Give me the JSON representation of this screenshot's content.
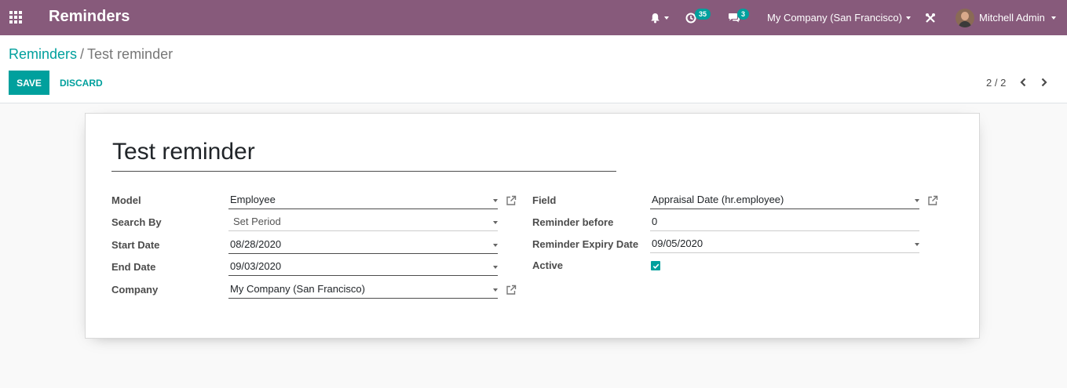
{
  "navbar": {
    "app_title": "Reminders",
    "activity_count": "35",
    "messages_count": "3",
    "company": "My Company (San Francisco)",
    "user_name": "Mitchell Admin"
  },
  "breadcrumb": {
    "parent": "Reminders",
    "separator": "/",
    "current": "Test reminder"
  },
  "buttons": {
    "save": "SAVE",
    "discard": "DISCARD"
  },
  "pager": {
    "value": "2 / 2"
  },
  "form": {
    "name": "Test reminder",
    "left": {
      "model_label": "Model",
      "model_value": "Employee",
      "search_by_label": "Search By",
      "search_by_value": "Set Period",
      "start_date_label": "Start Date",
      "start_date_value": "08/28/2020",
      "end_date_label": "End Date",
      "end_date_value": "09/03/2020",
      "company_label": "Company",
      "company_value": "My Company (San Francisco)"
    },
    "right": {
      "field_label": "Field",
      "field_value": "Appraisal Date (hr.employee)",
      "reminder_before_label": "Reminder before",
      "reminder_before_value": "0",
      "expiry_label": "Reminder Expiry Date",
      "expiry_value": "09/05/2020",
      "active_label": "Active",
      "active_checked": true
    }
  },
  "colors": {
    "navbar": "#875a7b",
    "accent": "#00a09d"
  }
}
